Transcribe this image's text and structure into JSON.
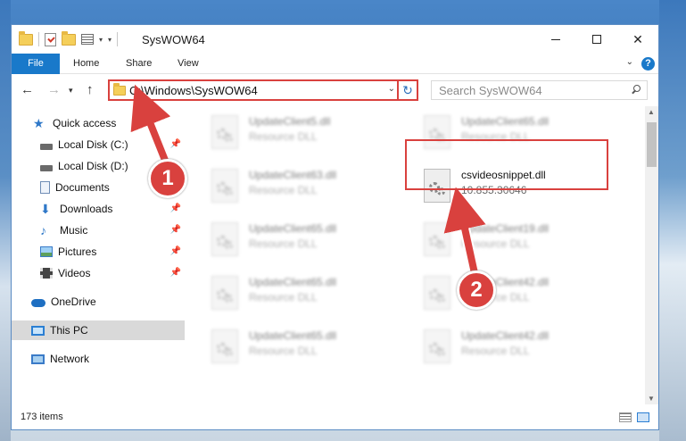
{
  "window": {
    "title": "SysWOW64",
    "controls": {
      "minimize": "—",
      "maximize": "☐",
      "close": "✕"
    }
  },
  "ribbon": {
    "tabs": [
      "File",
      "Home",
      "Share",
      "View"
    ],
    "help": "?"
  },
  "address_bar": {
    "path": "C:\\Windows\\SysWOW64",
    "search_placeholder": "Search SysWOW64"
  },
  "sidebar": {
    "items": [
      {
        "label": "Quick access",
        "icon": "star-icon",
        "pinned": false
      },
      {
        "label": "Local Disk (C:)",
        "icon": "disk-icon",
        "pinned": true
      },
      {
        "label": "Local Disk (D:)",
        "icon": "disk-icon",
        "pinned": false
      },
      {
        "label": "Documents",
        "icon": "documents-icon",
        "pinned": true
      },
      {
        "label": "Downloads",
        "icon": "downloads-icon",
        "pinned": true
      },
      {
        "label": "Music",
        "icon": "music-icon",
        "pinned": true
      },
      {
        "label": "Pictures",
        "icon": "pictures-icon",
        "pinned": true
      },
      {
        "label": "Videos",
        "icon": "videos-icon",
        "pinned": true
      },
      {
        "label": "OneDrive",
        "icon": "onedrive-icon",
        "pinned": false
      },
      {
        "label": "This PC",
        "icon": "this-pc-icon",
        "pinned": false,
        "selected": true
      },
      {
        "label": "Network",
        "icon": "network-icon",
        "pinned": false
      }
    ]
  },
  "files": [
    {
      "name": "UpdateClient5.dll",
      "sub": "Resource DLL"
    },
    {
      "name": "UpdateClient65.dll",
      "sub": "Resource DLL"
    },
    {
      "name": "UpdateClient63.dll",
      "sub": "Resource DLL"
    },
    {
      "name": "csvideosnippet.dll",
      "sub": "10.855.30646",
      "highlighted": true
    },
    {
      "name": "UpdateClient65.dll",
      "sub": "Resource DLL"
    },
    {
      "name": "UpdateClient19.dll",
      "sub": "Resource DLL"
    },
    {
      "name": "UpdateClient65.dll",
      "sub": "Resource DLL"
    },
    {
      "name": "UpdateClient42.dll",
      "sub": "Resource DLL"
    },
    {
      "name": "UpdateClient65.dll",
      "sub": "Resource DLL"
    },
    {
      "name": "UpdateClient42.dll",
      "sub": "Resource DLL"
    }
  ],
  "status": {
    "item_count": "173 items"
  },
  "callouts": [
    "1",
    "2"
  ],
  "colors": {
    "accent": "#1979ca",
    "highlight": "#d9413e"
  }
}
